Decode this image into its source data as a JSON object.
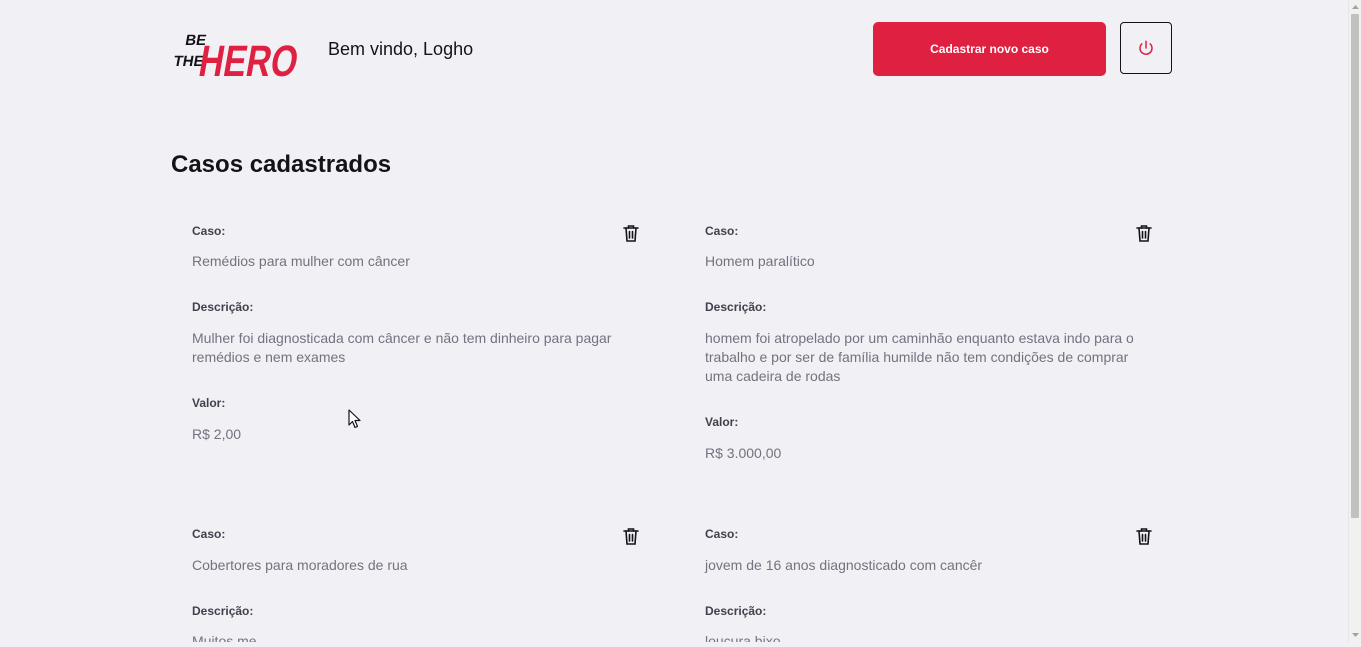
{
  "header": {
    "logo": {
      "line1": "BE",
      "line2": "THE",
      "word": "HERO"
    },
    "welcome": "Bem vindo, Logho",
    "new_case_label": "Cadastrar novo caso",
    "logout_icon": "power-icon"
  },
  "main": {
    "title": "Casos cadastrados",
    "cases": [
      {
        "case_label": "Caso:",
        "case_value": "Remédios para mulher com câncer",
        "description_label": "Descrição:",
        "description_value": "Mulher foi diagnosticada com câncer e não tem dinheiro para pagar remédios e nem exames",
        "value_label": "Valor:",
        "value_value": "R$ 2,00"
      },
      {
        "case_label": "Caso:",
        "case_value": "Homem paralítico",
        "description_label": "Descrição:",
        "description_value": "homem foi atropelado por um caminhão enquanto estava indo para o trabalho e por ser de família humilde não tem condições de comprar uma cadeira de rodas",
        "value_label": "Valor:",
        "value_value": "R$ 3.000,00"
      },
      {
        "case_label": "Caso:",
        "case_value": "Cobertores para moradores de rua",
        "description_label": "Descrição:",
        "description_value": "Muitos me"
      },
      {
        "case_label": "Caso:",
        "case_value": "jovem de 16 anos diagnosticado com cancêr",
        "description_label": "Descrição:",
        "description_value": "loucura bixo"
      }
    ]
  },
  "colors": {
    "brand": "#e02041",
    "background": "#f0f0f5",
    "text": "#13131a",
    "muted": "#737380"
  }
}
